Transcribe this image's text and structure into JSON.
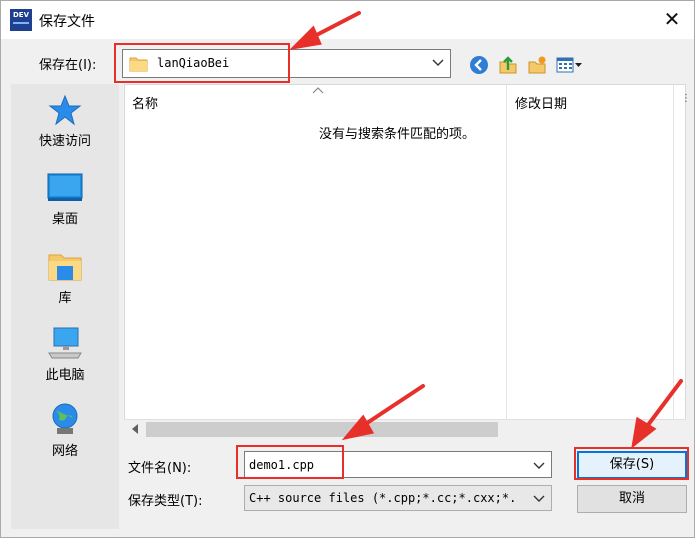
{
  "window": {
    "title": "保存文件",
    "app_icon_text": "DEV"
  },
  "location": {
    "label": "保存在(I):",
    "value": "lanQiaoBei"
  },
  "places": [
    {
      "label": "快速访问",
      "icon": "star-icon"
    },
    {
      "label": "桌面",
      "icon": "desktop-icon"
    },
    {
      "label": "库",
      "icon": "library-icon"
    },
    {
      "label": "此电脑",
      "icon": "computer-icon"
    },
    {
      "label": "网络",
      "icon": "network-icon"
    }
  ],
  "filelist": {
    "columns": [
      "名称",
      "修改日期"
    ],
    "empty_message": "没有与搜索条件匹配的项。"
  },
  "filename": {
    "label": "文件名(N):",
    "value": "demo1.cpp"
  },
  "filetype": {
    "label": "保存类型(T):",
    "value": "C++ source files (*.cpp;*.cc;*.cxx;*."
  },
  "buttons": {
    "save": "保存(S)",
    "cancel": "取消"
  },
  "colors": {
    "annotation_red": "#e8302a",
    "accent": "#0078d7",
    "folder": "#f5c96a"
  }
}
